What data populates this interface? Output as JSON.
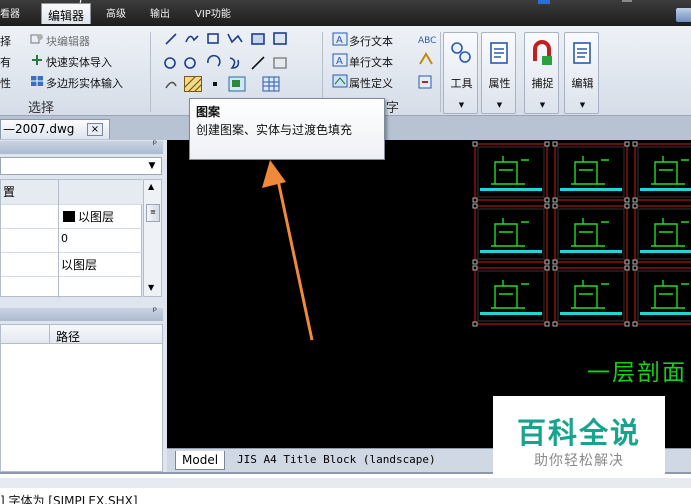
{
  "menubar": {
    "tabs": [
      {
        "label": "看器",
        "x": 0
      },
      {
        "label": "编辑器",
        "active": true
      },
      {
        "label": "高级"
      },
      {
        "label": "输出"
      },
      {
        "label": "VIP功能"
      }
    ],
    "title_tail": "（"
  },
  "ribbon": {
    "left_group": {
      "items": [
        "块编辑器",
        "快速实体导入",
        "多边形实体输入"
      ],
      "cut_prefixes": [
        "择",
        "有",
        "性"
      ],
      "label": "选择"
    },
    "text_group": {
      "items": [
        "多行文本",
        "单行文本",
        "属性定义"
      ],
      "label_tail": "字"
    },
    "tools": [
      {
        "label": "工具",
        "icon": "tools-icon"
      },
      {
        "label": "属性",
        "icon": "properties-icon"
      },
      {
        "label": "捕捉",
        "icon": "snap-icon"
      },
      {
        "label": "编辑",
        "icon": "edit-icon"
      }
    ],
    "caret": "▼"
  },
  "tooltip": {
    "title": "图案",
    "body": "创建图案、实体与过渡色填充"
  },
  "document_tab": {
    "label": "—2007.dwg",
    "close": "×"
  },
  "properties_panel": {
    "pin": "ᵖ",
    "combo_value": "",
    "header_cell": "置",
    "rows": [
      {
        "name": "",
        "value": "以图层",
        "has_swatch": true
      },
      {
        "name": "",
        "value": "0"
      },
      {
        "name": "",
        "value": "以图层"
      }
    ]
  },
  "files_panel": {
    "pin": "ᵖ",
    "columns": [
      "",
      "路径"
    ]
  },
  "canvas": {
    "title_text": "一层剖面",
    "colors": {
      "title": "#18d018",
      "frame": "#d01818",
      "drawing": "#22dd22",
      "cyan": "#18d8d8"
    }
  },
  "layout_tabs": {
    "model": "Model",
    "layout": "JIS A4 Title Block (landscape)"
  },
  "command_line": {
    "text": "] 字体为 [SIMPLEX.SHX]"
  },
  "watermark": {
    "main": "百科全说",
    "sub": "助你轻松解决"
  }
}
